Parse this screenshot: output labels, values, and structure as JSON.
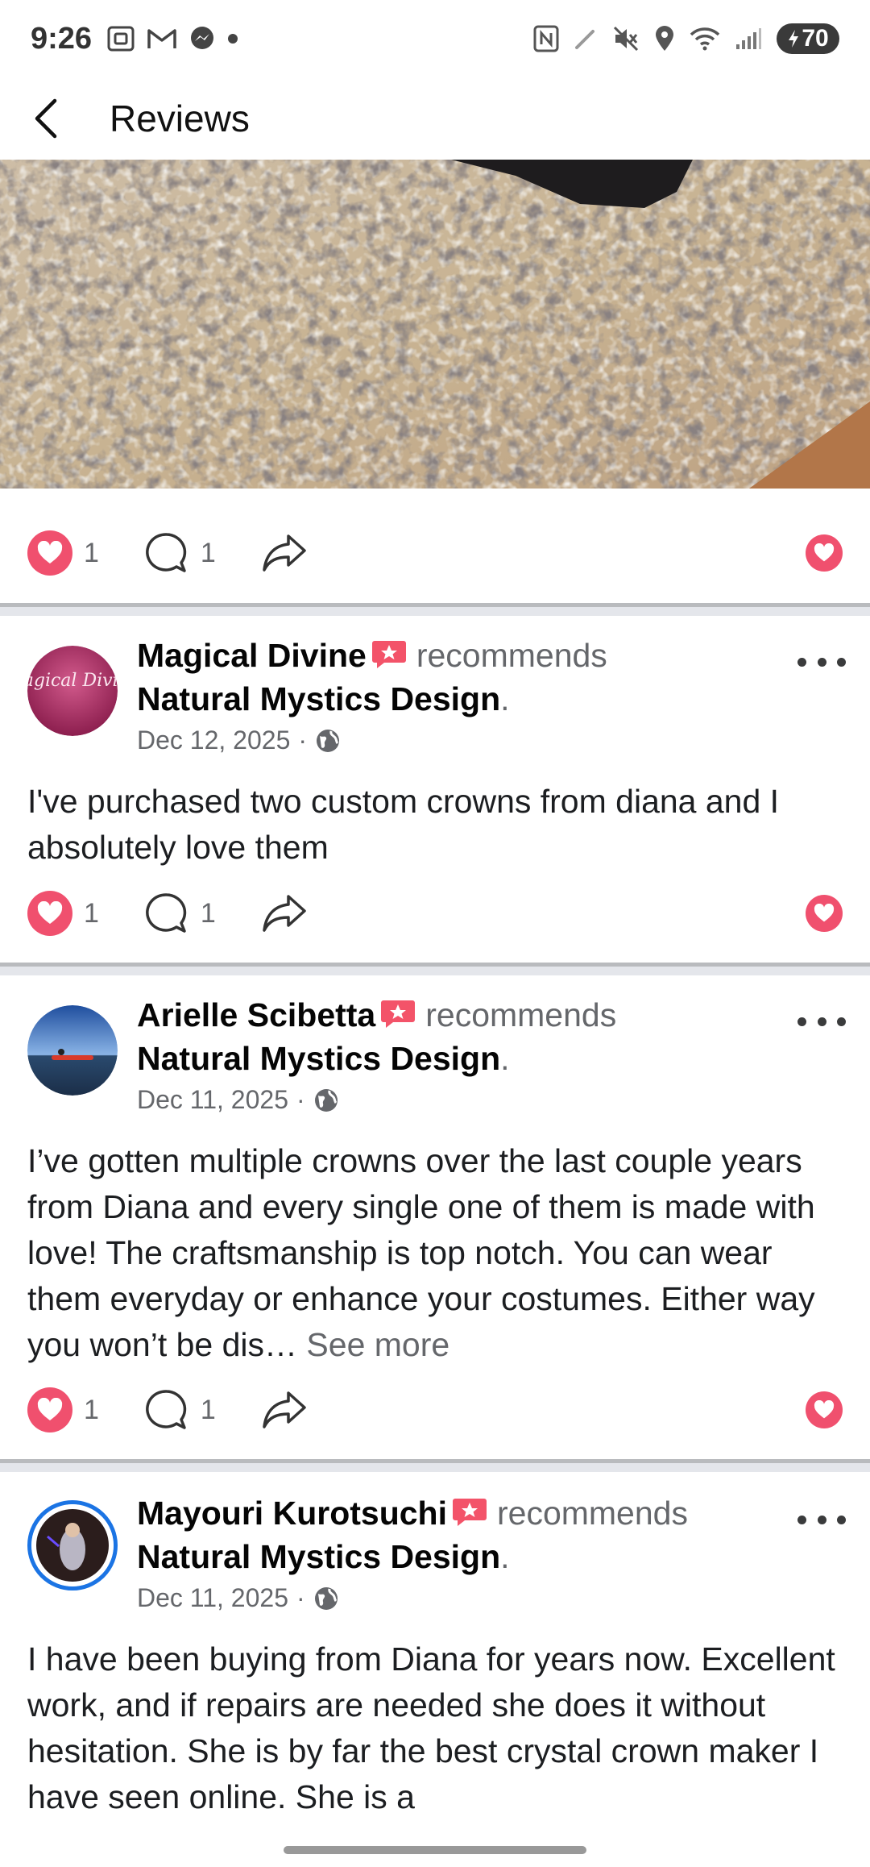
{
  "status_bar": {
    "time": "9:26",
    "battery": "70",
    "left_icons": [
      "screenshot-icon",
      "gmail-icon",
      "messenger-icon",
      "dot-icon"
    ],
    "right_icons": [
      "nfc-icon",
      "pen-icon",
      "mute-icon",
      "location-icon",
      "wifi-icon",
      "signal-icon"
    ]
  },
  "app_bar": {
    "title": "Reviews"
  },
  "colors": {
    "like": "#f0506e",
    "recommend": "#f35369",
    "muted_text": "#65676b",
    "divider": "#e4e6eb"
  },
  "first_post_actions": {
    "likes": "1",
    "comments": "1"
  },
  "reviews": [
    {
      "author": "Magical Divine",
      "recommends_word": "recommends",
      "page": "Natural Mystics Design",
      "period": ".",
      "date": "Dec 12, 2025",
      "date_sep": "·",
      "avatar_text": "Magical Divine",
      "text": "I've purchased two custom crowns from diana and I absolutely love them",
      "see_more": "",
      "likes": "1",
      "comments": "1"
    },
    {
      "author": "Arielle Scibetta",
      "recommends_word": "recommends",
      "page": "Natural Mystics Design",
      "period": ".",
      "date": "Dec 11, 2025",
      "date_sep": "·",
      "text": "I’ve gotten multiple crowns over the last couple years from Diana and every single one of them is made with love! The craftsmanship is top notch. You can wear them everyday or enhance your costumes. Either way you won’t be dis…",
      "see_more": "See more",
      "likes": "1",
      "comments": "1"
    },
    {
      "author": "Mayouri Kurotsuchi",
      "recommends_word": "recommends",
      "page": "Natural Mystics Design",
      "period": ".",
      "date": "Dec 11, 2025",
      "date_sep": "·",
      "text": "I have been buying from Diana for years now. Excellent work, and if repairs are needed she does it without hesitation. She is by far the best crystal crown maker I have seen online. She is a",
      "see_more": ""
    }
  ]
}
